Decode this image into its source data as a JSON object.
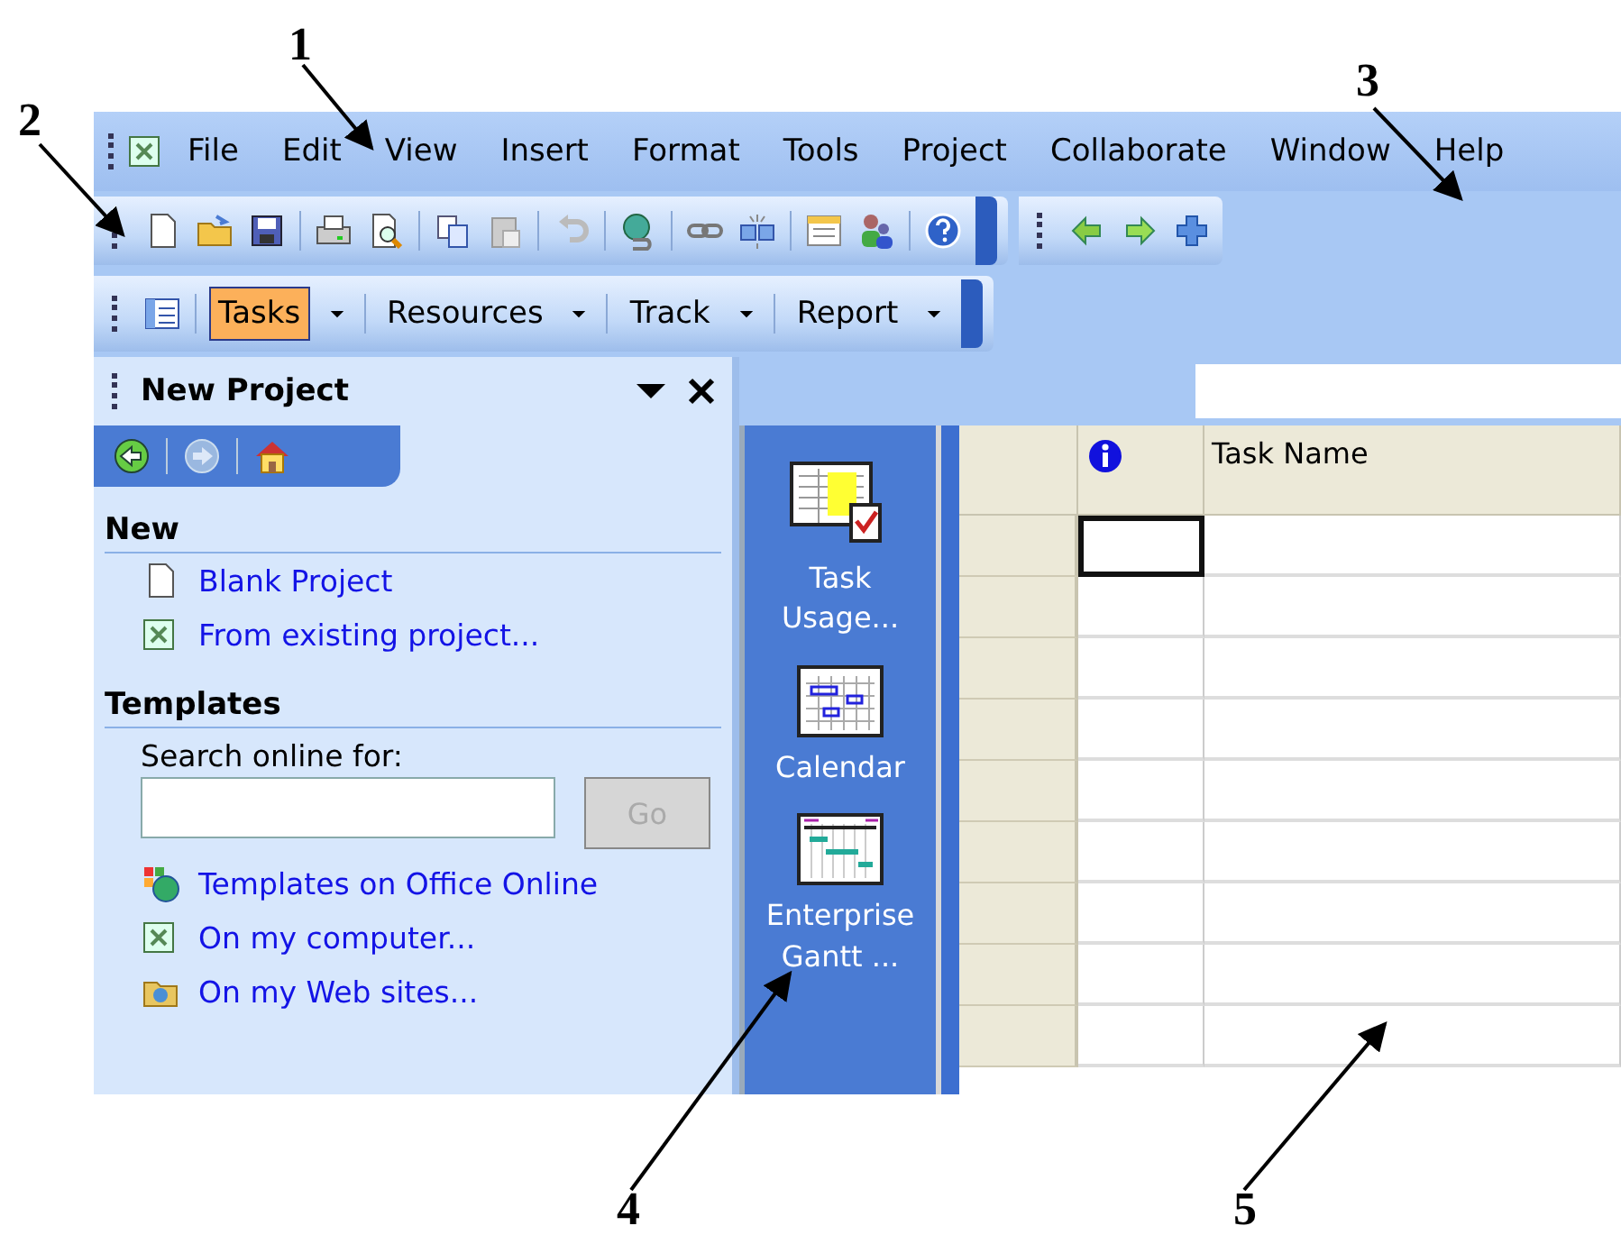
{
  "annotations": [
    {
      "label": "1"
    },
    {
      "label": "2"
    },
    {
      "label": "3"
    },
    {
      "label": "4"
    },
    {
      "label": "5"
    }
  ],
  "menu_bar": {
    "items": [
      "File",
      "Edit",
      "View",
      "Insert",
      "Format",
      "Tools",
      "Project",
      "Collaborate",
      "Window",
      "Help"
    ]
  },
  "view_toolbar": {
    "buttons": [
      {
        "label": "Tasks",
        "selected": true
      },
      {
        "label": "Resources",
        "selected": false
      },
      {
        "label": "Track",
        "selected": false
      },
      {
        "label": "Report",
        "selected": false
      }
    ]
  },
  "task_pane": {
    "title": "New Project",
    "sections": [
      {
        "heading": "New",
        "items": [
          {
            "label": "Blank Project",
            "kind": "document"
          },
          {
            "label": "From existing project...",
            "kind": "project"
          }
        ]
      },
      {
        "heading": "Templates",
        "search": {
          "label": "Search online for:",
          "button": "Go",
          "disabled": true
        },
        "items": [
          {
            "label": "Templates on Office Online",
            "kind": "globe"
          },
          {
            "label": "On my computer...",
            "kind": "project"
          },
          {
            "label": "On my Web sites...",
            "kind": "folder"
          }
        ]
      }
    ]
  },
  "view_bar": {
    "items": [
      {
        "label": "Task Usage...",
        "kind": "usage"
      },
      {
        "label": "Calendar",
        "kind": "calendar"
      },
      {
        "label": "Enterprise Gantt ...",
        "kind": "gantt"
      }
    ]
  },
  "table": {
    "columns": [
      {
        "kind": "indicator"
      },
      {
        "kind": "text",
        "label": "Task Name"
      }
    ],
    "rows": [
      {
        "active": true
      },
      {
        "active": false
      },
      {
        "active": false
      },
      {
        "active": false
      },
      {
        "active": false
      },
      {
        "active": false
      },
      {
        "active": false
      },
      {
        "active": false
      },
      {
        "active": false
      }
    ]
  }
}
